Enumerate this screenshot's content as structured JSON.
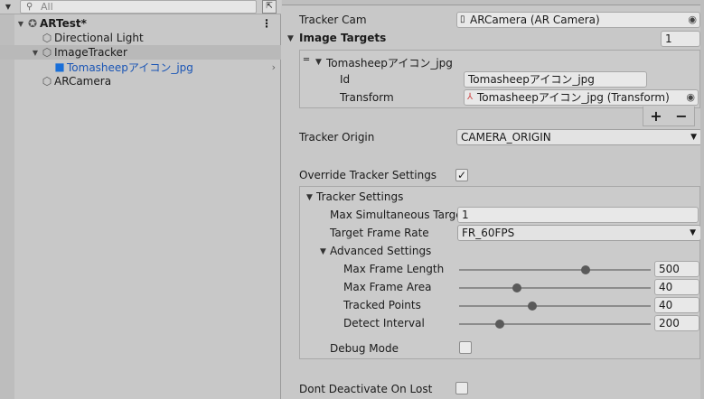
{
  "hierarchy": {
    "search_placeholder": "All",
    "scene_name": "ARTest*",
    "items": [
      {
        "label": "Directional Light"
      },
      {
        "label": "ImageTracker"
      },
      {
        "label": "Tomasheepアイコン_jpg"
      },
      {
        "label": "ARCamera"
      }
    ]
  },
  "inspector": {
    "tracker_cam_label": "Tracker Cam",
    "tracker_cam_value": "ARCamera (AR Camera)",
    "image_targets_label": "Image Targets",
    "image_targets_count": "1",
    "element_name": "Tomasheepアイコン_jpg",
    "id_label": "Id",
    "id_value": "Tomasheepアイコン_jpg",
    "transform_label": "Transform",
    "transform_value": "Tomasheepアイコン_jpg (Transform)",
    "plus": "+",
    "minus": "−",
    "tracker_origin_label": "Tracker Origin",
    "tracker_origin_value": "CAMERA_ORIGIN",
    "override_label": "Override Tracker Settings",
    "override_checked": "✓",
    "tracker_settings_label": "Tracker Settings",
    "max_sim_label": "Max Simultaneous Target",
    "max_sim_value": "1",
    "frame_rate_label": "Target Frame Rate",
    "frame_rate_value": "FR_60FPS",
    "advanced_label": "Advanced Settings",
    "sliders": [
      {
        "label": "Max Frame Length",
        "value": "500",
        "fraction": 0.66
      },
      {
        "label": "Max Frame Area",
        "value": "40",
        "fraction": 0.3
      },
      {
        "label": "Tracked Points",
        "value": "40",
        "fraction": 0.38
      },
      {
        "label": "Detect Interval",
        "value": "200",
        "fraction": 0.21
      }
    ],
    "debug_label": "Debug Mode",
    "dont_deactivate_label": "Dont Deactivate On Lost"
  }
}
